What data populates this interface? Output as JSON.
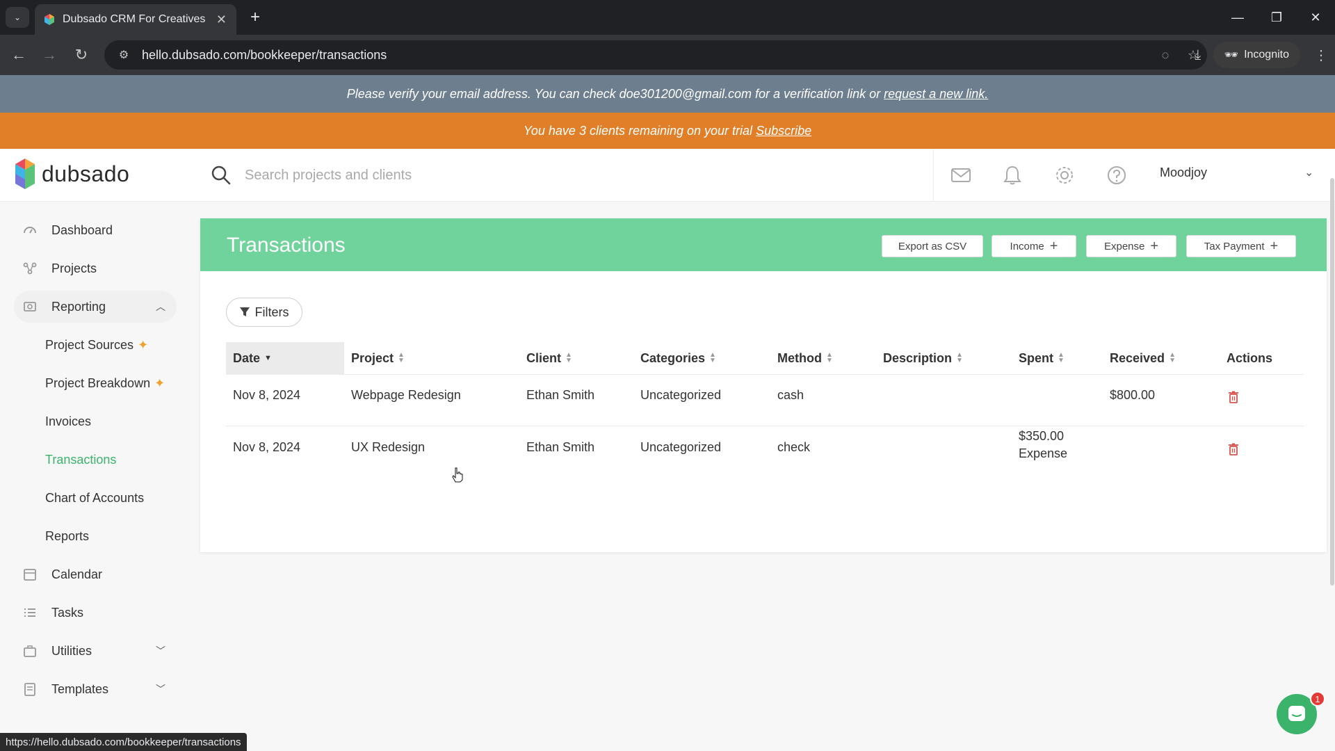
{
  "browser": {
    "tab_title": "Dubsado CRM For Creatives",
    "url": "hello.dubsado.com/bookkeeper/transactions",
    "incognito_label": "Incognito",
    "status_url": "https://hello.dubsado.com/bookkeeper/transactions"
  },
  "banners": {
    "verify_text": "Please verify your email address. You can check doe301200@gmail.com for a verification link or",
    "verify_link": "request a new link.",
    "trial_text": "You have 3 clients remaining on your trial",
    "trial_link": "Subscribe"
  },
  "header": {
    "logo_text": "dubsado",
    "search_placeholder": "Search projects and clients",
    "account_name": "Moodjoy"
  },
  "sidebar": {
    "items": [
      {
        "label": "Dashboard",
        "icon": "dashboard-icon"
      },
      {
        "label": "Projects",
        "icon": "projects-icon"
      },
      {
        "label": "Reporting",
        "icon": "reporting-icon"
      },
      {
        "label": "Calendar",
        "icon": "calendar-icon"
      },
      {
        "label": "Tasks",
        "icon": "tasks-icon"
      },
      {
        "label": "Utilities",
        "icon": "utilities-icon"
      },
      {
        "label": "Templates",
        "icon": "templates-icon"
      }
    ],
    "reporting_sub": [
      {
        "label": "Project Sources"
      },
      {
        "label": "Project Breakdown"
      },
      {
        "label": "Invoices"
      },
      {
        "label": "Transactions"
      },
      {
        "label": "Chart of Accounts"
      },
      {
        "label": "Reports"
      }
    ]
  },
  "page": {
    "title": "Transactions",
    "export_label": "Export as CSV",
    "income_label": "Income",
    "expense_label": "Expense",
    "tax_label": "Tax Payment",
    "filters_label": "Filters"
  },
  "table": {
    "columns": [
      "Date",
      "Project",
      "Client",
      "Categories",
      "Method",
      "Description",
      "Spent",
      "Received",
      "Actions"
    ],
    "rows": [
      {
        "date": "Nov 8, 2024",
        "project": "Webpage Redesign",
        "client": "Ethan Smith",
        "category": "Uncategorized",
        "method": "cash",
        "description": "",
        "spent": "",
        "spent_type": "",
        "received": "$800.00"
      },
      {
        "date": "Nov 8, 2024",
        "project": "UX Redesign",
        "client": "Ethan Smith",
        "category": "Uncategorized",
        "method": "check",
        "description": "",
        "spent": "$350.00",
        "spent_type": "Expense",
        "received": ""
      }
    ]
  },
  "chat": {
    "badge_count": "1"
  },
  "colors": {
    "accent_green": "#6fd39b",
    "active_green": "#3bb36b",
    "trial_orange": "#e07f27",
    "verify_slate": "#6d7e8f",
    "trash_red": "#d9534f"
  }
}
